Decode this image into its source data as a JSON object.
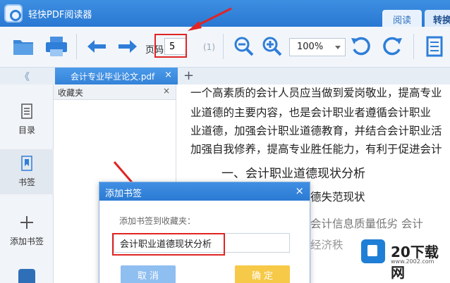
{
  "app": {
    "title": "轻快PDF阅读器"
  },
  "mode_tabs": {
    "read": "阅读",
    "convert": "转换"
  },
  "toolbar": {
    "page_label": "页码:",
    "page_value": "5",
    "page_total": "(1)",
    "zoom_value": "100%"
  },
  "tab": {
    "filename": "会计专业毕业论文.pdf",
    "close": "×",
    "add": "+",
    "collapse": "《"
  },
  "sidebar": {
    "items": [
      {
        "label": "目录",
        "icon": "toc-icon"
      },
      {
        "label": "书签",
        "icon": "bookmark-icon"
      },
      {
        "label": "添加书签",
        "icon": "plus-icon"
      }
    ]
  },
  "favorites": {
    "title": "收藏夹",
    "close": "×"
  },
  "document": {
    "lines": [
      "一个高素质的会计人员应当做到爱岗敬业，提高专业",
      "业道德的主要内容，也是会计职业者遵循会计职业",
      "业道德，加强会计职业道德教育，并结合会计职业活",
      "加强自我修养，提高专业胜任能力，有利于促进会计"
    ],
    "heading": "一、会计职业道德现状分析",
    "subheading": "德失范现状",
    "line_frag1": "会计信息质量低劣   会计",
    "line_frag2": "经济秩"
  },
  "dialog": {
    "title": "添加书签",
    "close": "×",
    "prompt": "添加书签到收藏夹：",
    "input_value": "会计职业道德现状分析",
    "cancel": "取 消",
    "ok": "确 定"
  },
  "watermark": {
    "text": "20下载网",
    "sub": "www.2002.com"
  },
  "colors": {
    "accent": "#2f7ed8",
    "annotation": "#e02424",
    "ok_button": "#f7c948"
  }
}
